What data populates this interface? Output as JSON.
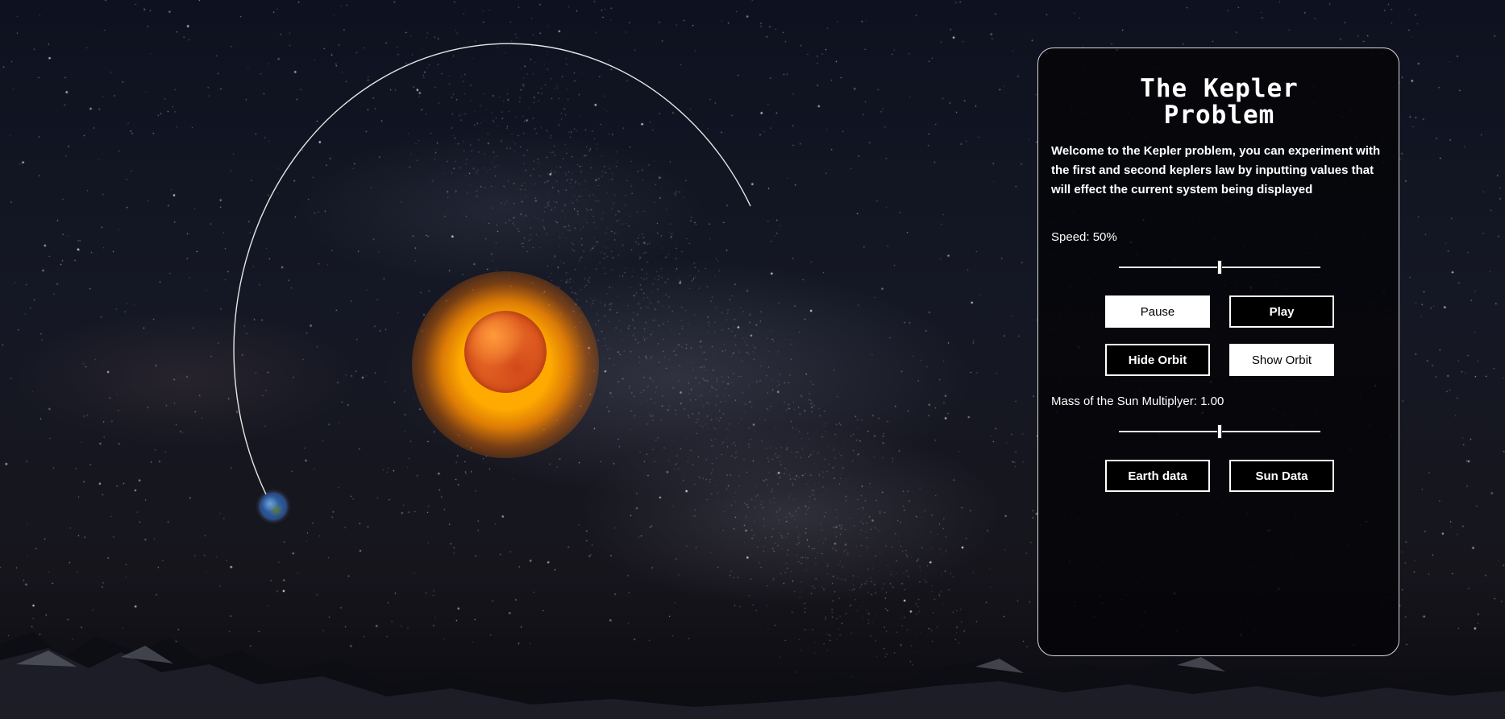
{
  "panel": {
    "title_line1": "The Kepler",
    "title_line2": "Problem",
    "intro": "Welcome to the Kepler problem, you can experiment with the first and second keplers law by inputting values that will effect the current system being displayed",
    "speed": {
      "label": "Speed:",
      "value_text": "50%",
      "level": 0.5
    },
    "controls": {
      "pause_label": "Pause",
      "play_label": "Play",
      "hide_orbit_label": "Hide Orbit",
      "show_orbit_label": "Show Orbit"
    },
    "mass": {
      "label": "Mass of the Sun Multiplyer:",
      "value_text": "1.00",
      "level": 0.5
    },
    "data_buttons": {
      "earth_label": "Earth data",
      "sun_label": "Sun Data"
    }
  },
  "scene": {
    "colors": {
      "orbit_line": "#e6e6e6",
      "sun_core": "#e0612a",
      "sun_glow": "#ffa500",
      "earth": "#3b6fb8"
    }
  }
}
